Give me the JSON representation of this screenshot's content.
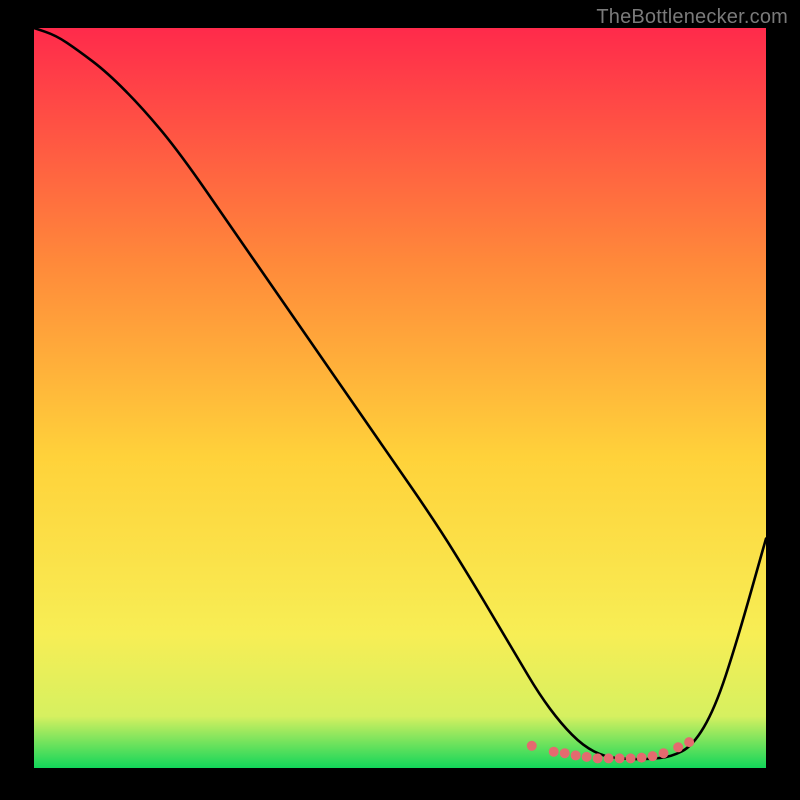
{
  "attribution": "TheBottlenecker.com",
  "chart_data": {
    "type": "line",
    "title": "",
    "xlabel": "",
    "ylabel": "",
    "xlim": [
      0,
      100
    ],
    "ylim": [
      0,
      100
    ],
    "grid": false,
    "legend": false,
    "background_gradient": {
      "top": "#ff2a4b",
      "mid_upper": "#ff8a3a",
      "mid": "#ffd23a",
      "mid_lower": "#f7ee55",
      "near_bottom": "#d6f060",
      "bottom": "#12d65a"
    },
    "series": [
      {
        "name": "curve",
        "x": [
          0,
          3,
          6,
          10,
          15,
          20,
          27,
          34,
          41,
          48,
          55,
          60,
          63,
          66,
          69,
          72,
          75,
          78,
          81,
          84,
          87,
          90,
          93,
          96,
          100
        ],
        "y": [
          100,
          99,
          97,
          94,
          89,
          83,
          73,
          63,
          53,
          43,
          33,
          25,
          20,
          15,
          10,
          6,
          3,
          1.5,
          1.2,
          1.2,
          1.5,
          3,
          8,
          17,
          31
        ],
        "color": "#000000",
        "width": 2.6
      }
    ],
    "markers": {
      "name": "bottom-cluster",
      "x": [
        68,
        71,
        72.5,
        74,
        75.5,
        77,
        78.5,
        80,
        81.5,
        83,
        84.5,
        86,
        88,
        89.5
      ],
      "y": [
        3.0,
        2.2,
        2.0,
        1.7,
        1.5,
        1.3,
        1.3,
        1.3,
        1.3,
        1.4,
        1.6,
        2.0,
        2.8,
        3.5
      ],
      "color": "#e46a6f",
      "radius": 5
    }
  }
}
